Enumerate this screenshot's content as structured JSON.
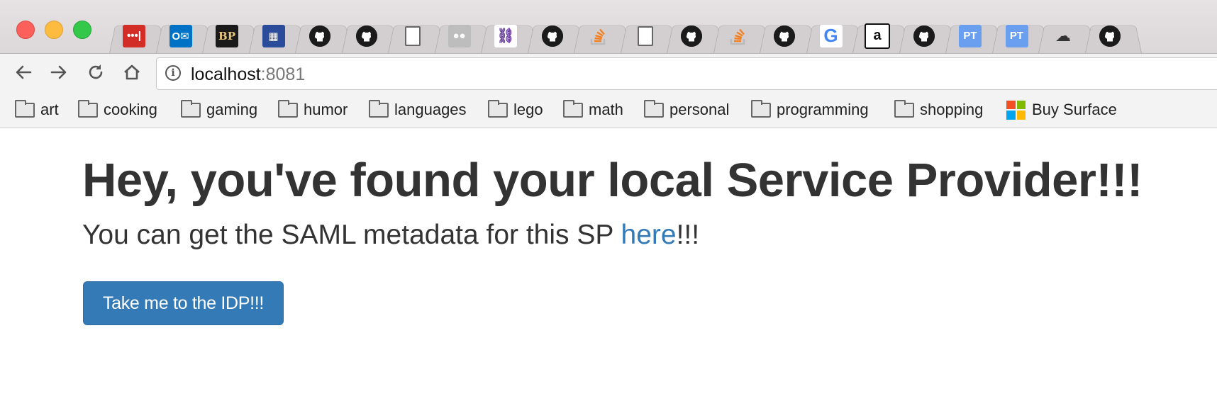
{
  "window": {
    "tabs": [
      {
        "icon": "lastpass-icon",
        "glyph": "•••|",
        "bg": "#d32d27"
      },
      {
        "icon": "outlook-icon",
        "glyph": "O✉",
        "bg": "#0072c6"
      },
      {
        "icon": "bp-logo-icon",
        "glyph": "BP",
        "bg": "#1a1a1a"
      },
      {
        "icon": "grid-app-icon",
        "glyph": "▦",
        "bg": "#2b4c9a"
      },
      {
        "icon": "github-icon",
        "glyph": "",
        "bg": "#1b1b1b"
      },
      {
        "icon": "github-icon",
        "glyph": "",
        "bg": "#1b1b1b"
      },
      {
        "icon": "document-icon",
        "glyph": "",
        "bg": "#ffffff"
      },
      {
        "icon": "badge-icon",
        "glyph": "●●",
        "bg": "#bdbdbd"
      },
      {
        "icon": "link-icon",
        "glyph": "⛓",
        "bg": "#ffffff"
      },
      {
        "icon": "github-icon",
        "glyph": "",
        "bg": "#1b1b1b"
      },
      {
        "icon": "stackoverflow-icon",
        "glyph": "≡",
        "bg": "transparent"
      },
      {
        "icon": "document-icon",
        "glyph": "",
        "bg": "#ffffff"
      },
      {
        "icon": "github-icon",
        "glyph": "",
        "bg": "#1b1b1b"
      },
      {
        "icon": "stackoverflow-icon",
        "glyph": "≡",
        "bg": "transparent"
      },
      {
        "icon": "github-icon",
        "glyph": "",
        "bg": "#1b1b1b"
      },
      {
        "icon": "google-icon",
        "glyph": "G",
        "bg": "#ffffff"
      },
      {
        "icon": "accessibility-icon",
        "glyph": "a",
        "bg": "#ffffff"
      },
      {
        "icon": "github-icon",
        "glyph": "",
        "bg": "#1b1b1b"
      },
      {
        "icon": "pivotal-tracker-icon",
        "glyph": "PT",
        "bg": "#6a9ff0"
      },
      {
        "icon": "pivotal-tracker-icon",
        "glyph": "PT",
        "bg": "#6a9ff0"
      },
      {
        "icon": "cloud-icon",
        "glyph": "☁",
        "bg": "transparent"
      },
      {
        "icon": "github-icon",
        "glyph": "",
        "bg": "#1b1b1b"
      }
    ]
  },
  "toolbar": {
    "url_host": "localhost",
    "url_port": ":8081"
  },
  "bookmarks": {
    "folders": [
      "art",
      "cooking",
      "gaming",
      "humor",
      "languages",
      "lego",
      "math",
      "personal",
      "programming",
      "shopping"
    ],
    "link_label": "Buy Surface",
    "ms_colors": [
      "#f25022",
      "#7fba00",
      "#00a4ef",
      "#ffb900"
    ]
  },
  "page": {
    "heading": "Hey, you've found your local Service Provider!!!",
    "lead_prefix": "You can get the SAML metadata for this SP ",
    "lead_link": "here",
    "lead_suffix": "!!!",
    "button_label": "Take me to the IDP!!!",
    "colors": {
      "text": "#333333",
      "link": "#337ab7",
      "button": "#337ab7"
    }
  }
}
